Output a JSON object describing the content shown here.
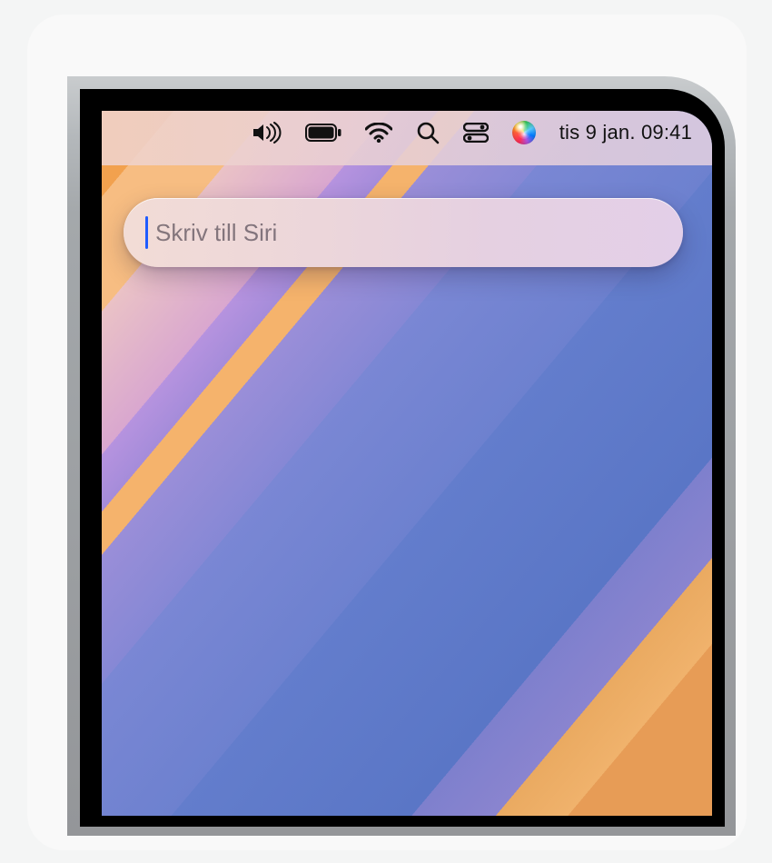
{
  "menubar": {
    "datetime": "tis 9 jan. 09:41",
    "icons": {
      "volume": "volume-icon",
      "battery": "battery-icon",
      "wifi": "wifi-icon",
      "spotlight": "search-icon",
      "control_center": "control-center-icon",
      "siri": "siri-icon"
    }
  },
  "siri": {
    "placeholder": "Skriv till Siri",
    "value": ""
  },
  "colors": {
    "caret": "#1e5bff",
    "text": "#111111"
  }
}
